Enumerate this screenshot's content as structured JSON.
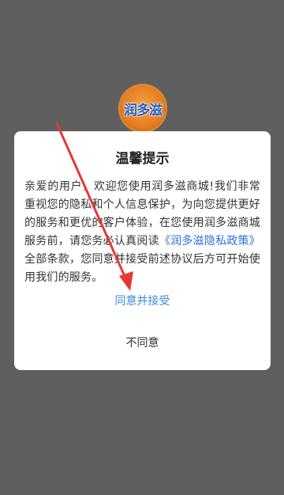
{
  "logo": {
    "text": "润多滋"
  },
  "dialog": {
    "title": "温馨提示",
    "body_text": "亲爱的用户，欢迎您使用润多滋商城!我们非常重视您的隐私和个人信息保护，为向您提供更好的服务和更优的客户体验，在您使用润多滋商城服务前，请您务必认真阅读",
    "policy_link": "《润多滋隐私政策》",
    "body_text_after": "全部条款，您同意并接受前述协议后方可开始使用我们的服务。",
    "agree_label": "同意并接受",
    "disagree_label": "不同意"
  },
  "colors": {
    "overlay": "#5f5f5f",
    "link": "#2a6fdc",
    "agree": "#3d8ad8",
    "annotation_arrow": "#e53935"
  }
}
